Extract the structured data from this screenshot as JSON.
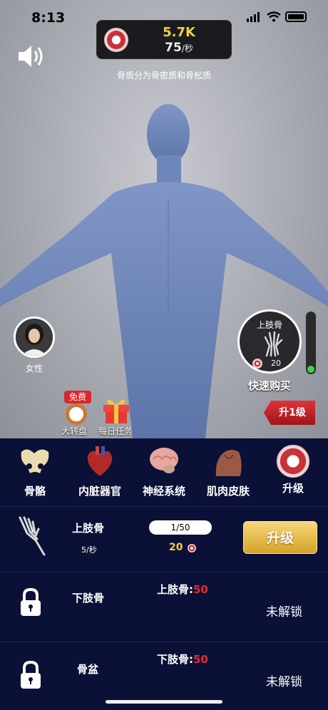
{
  "status_bar": {
    "time": "8:13"
  },
  "score": {
    "amount": "5.7K",
    "rate": "75",
    "rate_unit": "/秒"
  },
  "tip": "骨质分为骨密质和骨松质",
  "gender": {
    "label": "女性"
  },
  "quick_buy": {
    "title": "上肢骨",
    "cost": "20",
    "label": "快速购买",
    "level_fraction": 0.12
  },
  "activities": {
    "free_badge": "免费",
    "wheel_label": "大转盘",
    "daily_label": "每日任务"
  },
  "upgrade_ribbon": "升1级",
  "categories": [
    {
      "label": "骨骼",
      "icon": "pelvis-icon"
    },
    {
      "label": "内脏器官",
      "icon": "heart-icon"
    },
    {
      "label": "神经系统",
      "icon": "brain-icon"
    },
    {
      "label": "肌肉皮肤",
      "icon": "muscle-icon"
    },
    {
      "label": "升级",
      "icon": "bone-coin-icon"
    }
  ],
  "items": [
    {
      "name": "上肢骨",
      "rate": "5/秒",
      "progress": "1/50",
      "cost": "20",
      "button": "升级"
    },
    {
      "name": "下肢骨",
      "req_label": "上肢骨:",
      "req_value": "50",
      "status": "未解锁"
    },
    {
      "name": "骨盆",
      "req_label": "下肢骨:",
      "req_value": "50",
      "status": "未解锁"
    }
  ],
  "colors": {
    "accent_gold": "#f4d23c",
    "lock_red": "#e02a35",
    "panel_bg": "#0b1036",
    "level_green": "#3fd14a"
  }
}
